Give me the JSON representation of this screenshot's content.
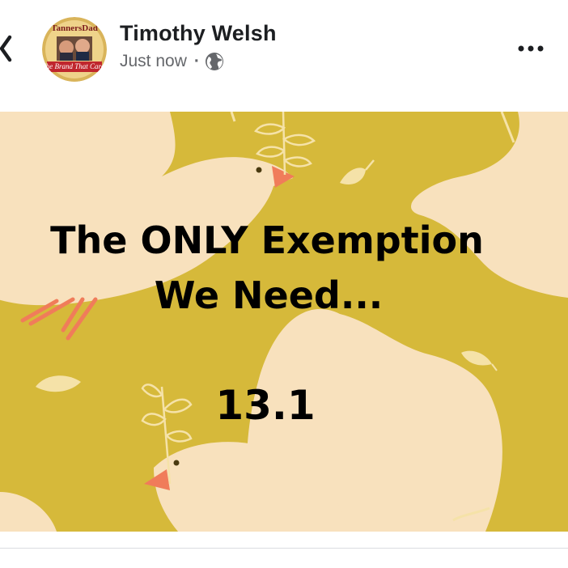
{
  "post": {
    "author": "Timothy Welsh",
    "timestamp": "Just now",
    "separator": "·",
    "privacy_icon": "globe-icon",
    "avatar_text_top": "TannersDad",
    "avatar_text_bottom": "The Brand That Cares"
  },
  "image": {
    "line1": "The ONLY Exemption",
    "line2": "We Need...",
    "number": "13.1"
  },
  "colors": {
    "background": "#d6b93a",
    "dove": "#f8e1bd",
    "beak": "#f07c5a",
    "leaf": "#f5e2a8",
    "text": "#000000"
  }
}
